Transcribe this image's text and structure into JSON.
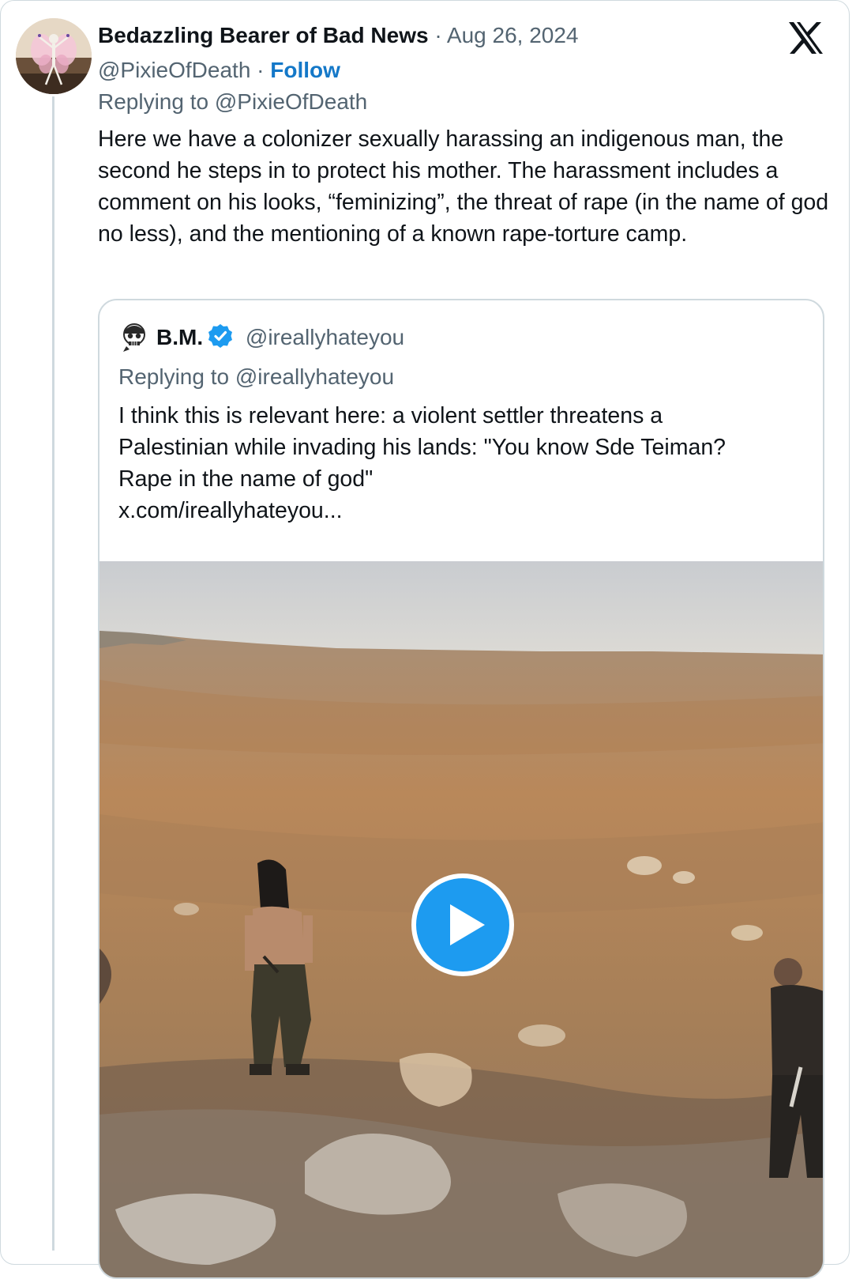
{
  "tweet": {
    "author_name": "Bedazzling Bearer of Bad News",
    "separator": "·",
    "date": "Aug 26, 2024",
    "handle": "@PixieOfDeath",
    "follow_label": "Follow",
    "replying_to": "Replying to @PixieOfDeath",
    "text": "Here we have a colonizer sexually harassing an indigenous man, the second he steps in to protect his mother. The harassment includes a comment on his looks, “feminizing”, the threat of rape (in the name of god no less), and the mentioning of a known rape-torture camp."
  },
  "quoted_tweet": {
    "author_name": "B.M.",
    "handle": "@ireallyhateyou",
    "replying_to": "Replying to @ireallyhateyou",
    "text_lines": [
      "I think this is relevant here: a violent settler threatens a",
      "Palestinian while invading his lands: \"You know Sde Teiman?",
      "Rape in the name of god\"",
      "x.com/ireallyhateyou..."
    ]
  },
  "icons": {
    "platform_logo": "x-logo-icon",
    "verified": "verified-badge-icon",
    "play": "play-icon"
  },
  "colors": {
    "follow": "#1478c8",
    "verified": "#1d9bf0",
    "play_button": "#1d9bf0",
    "muted_text": "#536471",
    "border": "#cfd9de"
  }
}
